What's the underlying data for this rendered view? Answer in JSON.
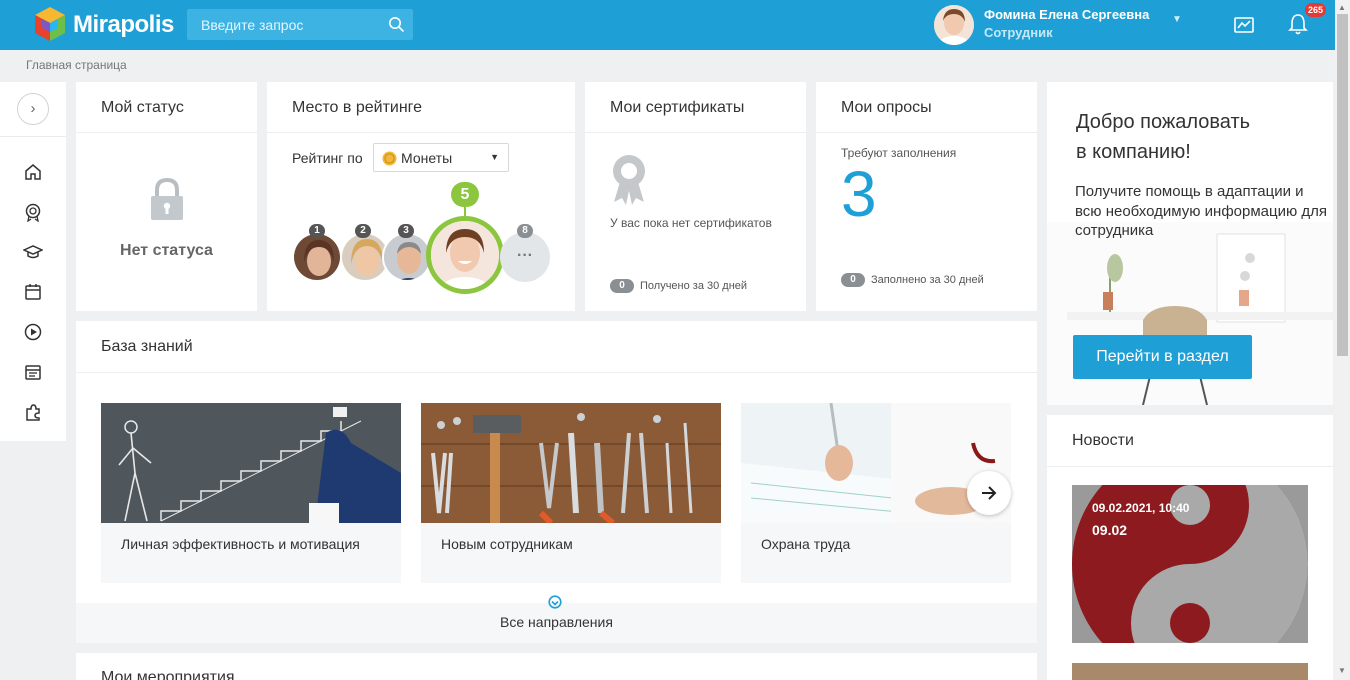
{
  "app": {
    "name": "Mirapolis"
  },
  "search": {
    "placeholder": "Введите запрос"
  },
  "user": {
    "name": "Фомина Елена Сергеевна",
    "role": "Сотрудник"
  },
  "notifications": {
    "count": "265"
  },
  "breadcrumb": "Главная страница",
  "status_card": {
    "title": "Мой статус",
    "value": "Нет статуса"
  },
  "rating_card": {
    "title": "Место в рейтинге",
    "rating_by_label": "Рейтинг по",
    "rating_select_value": "Монеты",
    "places": [
      "1",
      "2",
      "3",
      "5",
      "8"
    ],
    "more_label": "···"
  },
  "certificates_card": {
    "title": "Мои сертификаты",
    "empty_text": "У вас пока нет сертификатов",
    "count": "0",
    "count_label": "Получено за 30 дней"
  },
  "surveys_card": {
    "title": "Мои опросы",
    "pending_label": "Требуют заполнения",
    "pending_count": "3",
    "count": "0",
    "count_label": "Заполнено за 30 дней"
  },
  "welcome_card": {
    "title_line1": "Добро пожаловать",
    "title_line2": "в компанию!",
    "text": "Получите помощь в адаптации и всю необходимую информацию для сотрудника",
    "button_label": "Перейти в раздел"
  },
  "knowledge_base": {
    "title": "База знаний",
    "items": [
      {
        "label": "Личная эффективность и мотивация"
      },
      {
        "label": "Новым сотрудникам"
      },
      {
        "label": "Охрана труда"
      }
    ],
    "all_label": "Все направления"
  },
  "events": {
    "title": "Мои мероприятия"
  },
  "news": {
    "title": "Новости",
    "items": [
      {
        "date": "09.02.2021, 10:40",
        "headline": "09.02"
      }
    ]
  },
  "colors": {
    "topbar": "#1e9fd6",
    "accent": "#1e9fd6",
    "rank_highlight": "#8cc63f"
  }
}
